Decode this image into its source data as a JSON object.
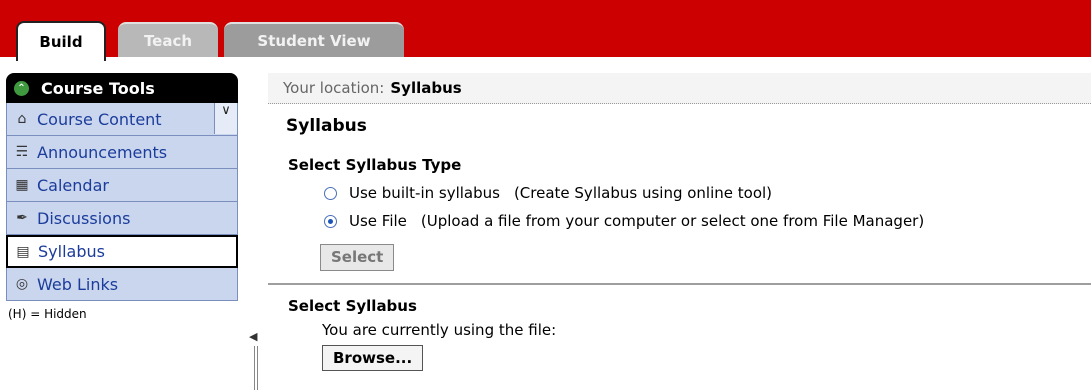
{
  "tabs": {
    "build": "Build",
    "teach": "Teach",
    "student_view": "Student View"
  },
  "sidebar": {
    "header": "Course Tools",
    "items": [
      {
        "label": "Course Content",
        "icon": "home-icon"
      },
      {
        "label": "Announcements",
        "icon": "megaphone-icon"
      },
      {
        "label": "Calendar",
        "icon": "calendar-icon"
      },
      {
        "label": "Discussions",
        "icon": "pin-icon"
      },
      {
        "label": "Syllabus",
        "icon": "book-icon"
      },
      {
        "label": "Web Links",
        "icon": "globe-icon"
      }
    ],
    "hidden_note": "(H) = Hidden"
  },
  "location": {
    "prefix": "Your location:",
    "current": "Syllabus"
  },
  "main": {
    "title": "Syllabus",
    "section1_title": "Select Syllabus Type",
    "options": [
      {
        "label": "Use built-in syllabus",
        "desc": "(Create Syllabus using online tool)",
        "checked": false
      },
      {
        "label": "Use File",
        "desc": "(Upload a file from your computer or select one from File Manager)",
        "checked": true
      }
    ],
    "select_button": "Select",
    "section2_title": "Select Syllabus",
    "using_text": "You are currently using the file:",
    "browse_button": "Browse..."
  },
  "colors": {
    "header_red": "#cc0000",
    "nav_bg": "#cad6ee",
    "nav_text": "#1b3c9b"
  }
}
